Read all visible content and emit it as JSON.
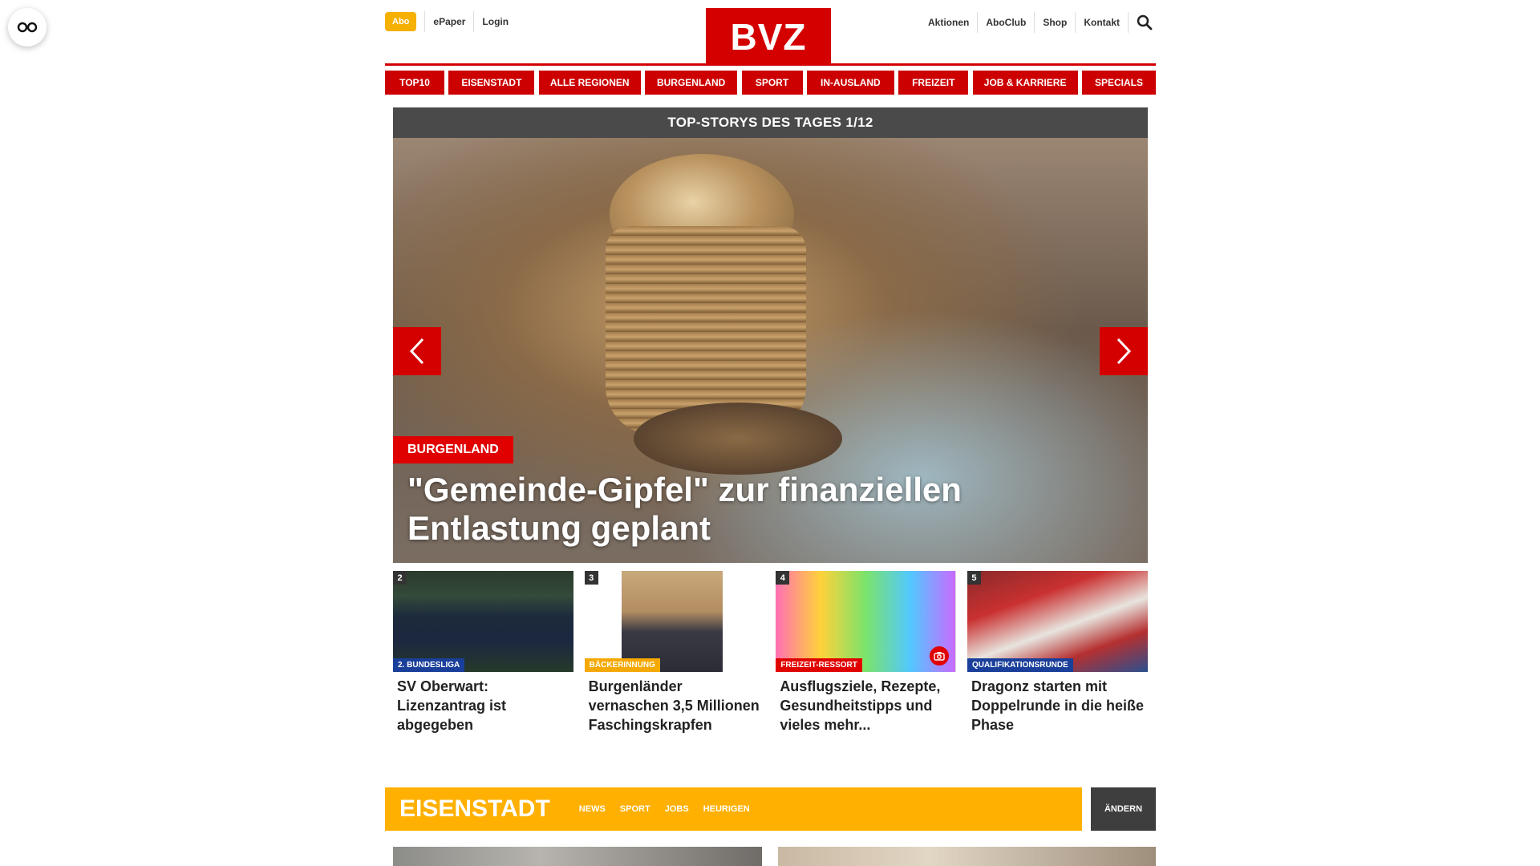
{
  "header": {
    "abo_label": "Abo",
    "left_links": [
      "ePaper",
      "Login"
    ],
    "logo_text": "BVZ",
    "right_links": [
      "Aktionen",
      "AboClub",
      "Shop",
      "Kontakt"
    ]
  },
  "nav": {
    "items": [
      "TOP10",
      "EISENSTADT",
      "ALLE REGIONEN",
      "BURGENLAND",
      "SPORT",
      "IN-AUSLAND",
      "FREIZEIT",
      "JOB & KARRIERE",
      "SPECIALS"
    ]
  },
  "hero": {
    "heading": "TOP-STORYS DES TAGES 1/12",
    "category": "BURGENLAND",
    "title": "\"Gemeinde-Gipfel\" zur finanziellen Entlastung geplant"
  },
  "teasers": [
    {
      "number": "2",
      "tag": "2. BUNDESLIGA",
      "tag_color": "#1a3f9a",
      "title": "SV Oberwart: Lizenzantrag ist abgegeben"
    },
    {
      "number": "3",
      "tag": "BÄCKERINNUNG",
      "tag_color": "#f5a800",
      "title": "Burgenländer vernaschen 3,5 Millionen Faschingskrapfen"
    },
    {
      "number": "4",
      "tag": "FREIZEIT-RESSORT",
      "tag_color": "#e00000",
      "title": "Ausflugsziele, Rezepte, Gesundheitstipps und vieles mehr..."
    },
    {
      "number": "5",
      "tag": "QUALIFIKATIONSRUNDE",
      "tag_color": "#1a3f9a",
      "title": "Dragonz starten mit Doppelrunde in die heiße Phase"
    }
  ],
  "region": {
    "title": "EISENSTADT",
    "links": [
      "NEWS",
      "SPORT",
      "JOBS",
      "HEURIGEN"
    ],
    "change_label": "ÄNDERN"
  },
  "colors": {
    "brand_red": "#d40000",
    "abo_yellow": "#f5b000",
    "region_yellow": "#ffb000",
    "dark_gray": "#4a4a4a"
  }
}
